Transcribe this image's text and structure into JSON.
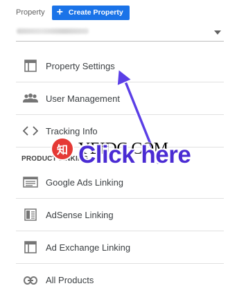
{
  "header": {
    "label": "Property",
    "create_button": "Create Property"
  },
  "selector": {
    "value": "",
    "caret_icon": "caret-down-icon"
  },
  "menu": [
    {
      "label": "Property Settings",
      "icon": "property-settings-icon"
    },
    {
      "label": "User Management",
      "icon": "people-icon"
    },
    {
      "label": "Tracking Info",
      "icon": "code-icon"
    }
  ],
  "section_title": "PRODUCT LINKING",
  "linking": [
    {
      "label": "Google Ads Linking",
      "icon": "google-ads-icon"
    },
    {
      "label": "AdSense Linking",
      "icon": "adsense-icon"
    },
    {
      "label": "Ad Exchange Linking",
      "icon": "ad-exchange-icon"
    },
    {
      "label": "All Products",
      "icon": "link-icon"
    }
  ],
  "overlay": {
    "watermark_badge": "知",
    "watermark_text": "YEIDC.COM",
    "callout": "Click here",
    "arrow_color": "#5b3fe6",
    "callout_color": "#4a2bd3"
  },
  "colors": {
    "accent": "#1a73e8"
  }
}
